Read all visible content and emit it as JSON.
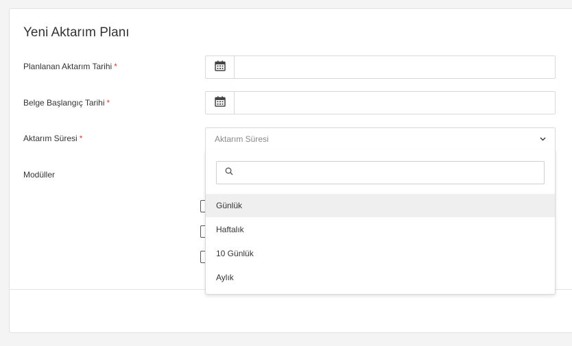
{
  "form": {
    "title": "Yeni Aktarım Planı",
    "required_mark": "*",
    "planned_date": {
      "label": "Planlanan Aktarım Tarihi",
      "value": ""
    },
    "document_start_date": {
      "label": "Belge Başlangıç Tarihi",
      "value": ""
    },
    "transfer_period": {
      "label": "Aktarım Süresi",
      "placeholder": "Aktarım Süresi"
    },
    "modules": {
      "label": "Modüller"
    }
  },
  "dropdown": {
    "search_value": "",
    "options": [
      "Günlük",
      "Haftalık",
      "10 Günlük",
      "Aylık"
    ],
    "highlighted_index": 0
  },
  "icons": {
    "date_addon": "calendar-icon",
    "select_toggle": "chevron-down-icon",
    "search": "search-icon"
  },
  "colors": {
    "required": "#e53935",
    "page_background": "#f4f4f4",
    "highlight": "#efefef"
  }
}
